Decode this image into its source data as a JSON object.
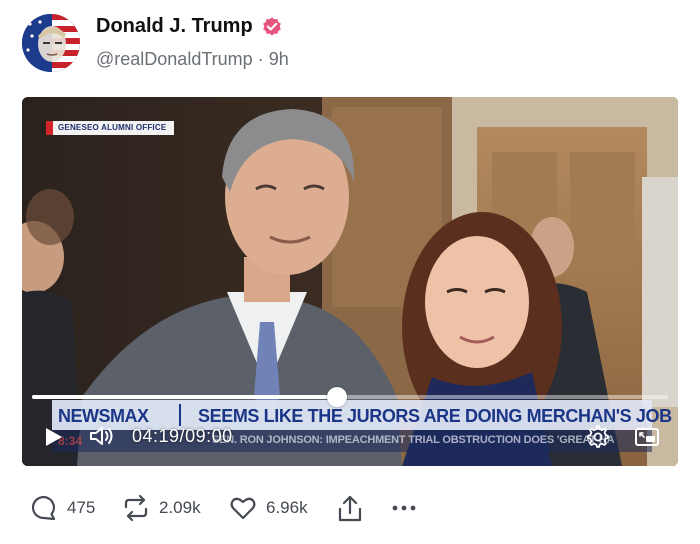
{
  "post": {
    "display_name": "Donald J. Trump",
    "handle": "@realDonaldTrump",
    "separator": "·",
    "age": "9h"
  },
  "video": {
    "source_tag": "GENESEO ALUMNI OFFICE",
    "network": "NEWSMAX",
    "headline": "SEEMS LIKE THE JURORS ARE DOING MERCHAN'S JOB",
    "ticker_time": "8:34",
    "ticker_text": "SEN. RON JOHNSON: IMPEACHMENT TRIAL OBSTRUCTION DOES 'GREAT HA",
    "current_time": "04:19",
    "time_separator": "/",
    "duration": "09:00",
    "progress_fraction": 0.48
  },
  "actions": {
    "replies": "475",
    "reposts": "2.09k",
    "likes": "6.96k"
  },
  "colors": {
    "verified": "#e6557d",
    "newsmax_blue": "#1b3687",
    "icon_gray": "#454a52"
  }
}
